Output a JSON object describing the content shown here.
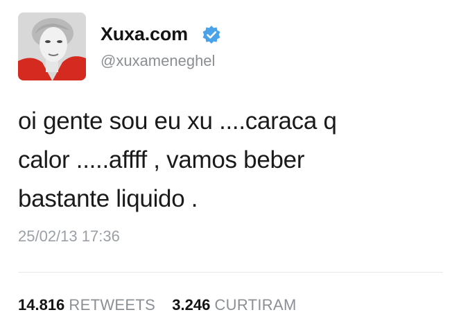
{
  "user": {
    "display_name": "Xuxa.com",
    "handle": "@xuxameneghel",
    "verified_icon": "verified-badge-icon",
    "avatar_icon": "profile-photo"
  },
  "tweet": {
    "line1": "oi gente sou eu xu ....caraca q",
    "line2": "calor .....affff , vamos beber",
    "line3": "bastante liquido .",
    "timestamp": "25/02/13 17:36"
  },
  "stats": {
    "retweets_count": "14.816",
    "retweets_label": "RETWEETS",
    "likes_count": "3.246",
    "likes_label": "CURTIRAM"
  },
  "colors": {
    "verified_blue": "#4aa3e8",
    "secondary_text": "#8a8f94",
    "avatar_red": "#d42a1f"
  }
}
